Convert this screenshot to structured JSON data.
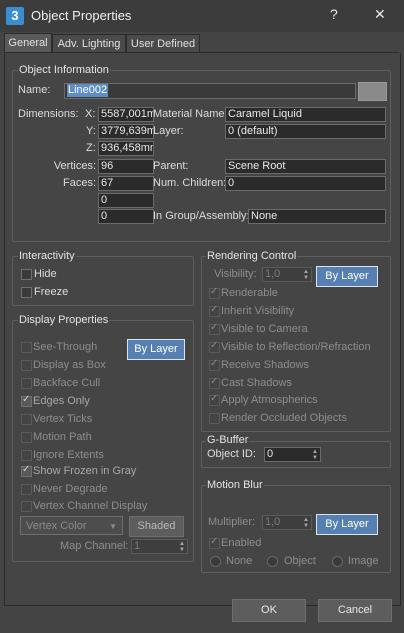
{
  "window": {
    "icon": "3",
    "title": "Object Properties",
    "help": "?",
    "close": "✕"
  },
  "tabs": [
    "General",
    "Adv. Lighting",
    "User Defined"
  ],
  "object_info": {
    "title": "Object Information",
    "name_label": "Name:",
    "name_value": "Line002",
    "dimensions_label": "Dimensions:",
    "x_label": "X:",
    "x_value": "5587,001m",
    "y_label": "Y:",
    "y_value": "3779,639m",
    "z_label": "Z:",
    "z_value": "936,458mm",
    "material_label": "Material Name:",
    "material_value": "Caramel Liquid",
    "layer_label": "Layer:",
    "layer_value": "0 (default)",
    "vertices_label": "Vertices:",
    "vertices_value": "96",
    "faces_label": "Faces:",
    "faces_value": "67",
    "blank1": "0",
    "blank2": "0",
    "parent_label": "Parent:",
    "parent_value": "Scene Root",
    "children_label": "Num. Children:",
    "children_value": "0",
    "group_label": "In Group/Assembly:",
    "group_value": "None"
  },
  "interactivity": {
    "title": "Interactivity",
    "hide": "Hide",
    "freeze": "Freeze"
  },
  "display": {
    "title": "Display Properties",
    "by_layer": "By Layer",
    "items": [
      "See-Through",
      "Display as Box",
      "Backface Cull",
      "Edges Only",
      "Vertex Ticks",
      "Motion Path",
      "Ignore Extents",
      "Show Frozen in Gray",
      "Never Degrade",
      "Vertex Channel Display"
    ],
    "vertex_color": "Vertex Color",
    "shaded": "Shaded",
    "map_channel_label": "Map Channel:",
    "map_channel_value": "1"
  },
  "rendering": {
    "title": "Rendering Control",
    "visibility_label": "Visibility:",
    "visibility_value": "1,0",
    "by_layer": "By Layer",
    "items": [
      "Renderable",
      "Inherit Visibility",
      "Visible to Camera",
      "Visible to Reflection/Refraction",
      "Receive Shadows",
      "Cast Shadows",
      "Apply Atmospherics",
      "Render Occluded Objects"
    ]
  },
  "gbuffer": {
    "title": "G-Buffer",
    "object_id_label": "Object ID:",
    "object_id_value": "0"
  },
  "motion_blur": {
    "title": "Motion Blur",
    "multiplier_label": "Multiplier:",
    "multiplier_value": "1,0",
    "by_layer": "By Layer",
    "enabled": "Enabled",
    "radios": [
      "None",
      "Object",
      "Image"
    ]
  },
  "footer": {
    "ok": "OK",
    "cancel": "Cancel"
  },
  "colors": {
    "accent": "#567fb2",
    "background": "#444444"
  }
}
